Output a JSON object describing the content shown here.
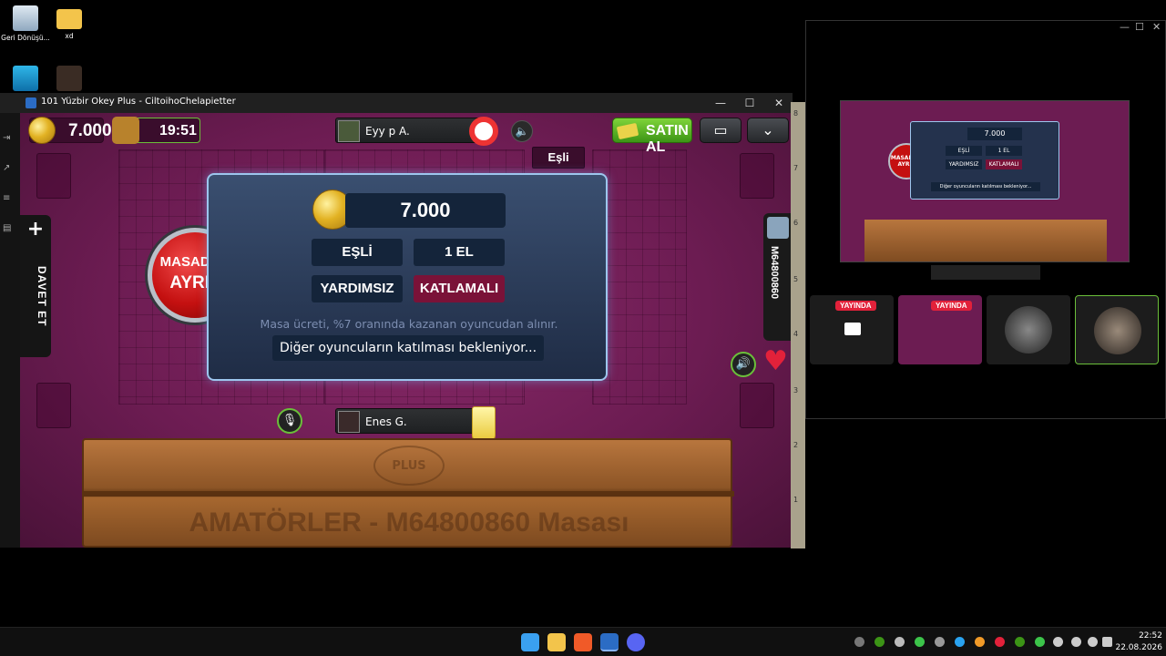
{
  "desktop": {
    "icons": [
      {
        "name": "recycle-bin",
        "label": "Geri Dönüşü..."
      },
      {
        "name": "folder",
        "label": "xd"
      }
    ]
  },
  "window": {
    "title": "101 Yüzbir Okey Plus - CiltoihoChelapietter",
    "minimize": "—",
    "maximize": "☐",
    "close": "✕"
  },
  "hud": {
    "chips": "7.000",
    "timer": "19:51",
    "top_player": "Eyy p A.",
    "buy_label": "SATIN AL",
    "team_label": "Eşli"
  },
  "left_panel": {
    "invite_label": "DAVET ET"
  },
  "right_player": {
    "name": "M64800860"
  },
  "leave_button": {
    "line1": "MASADAN",
    "line2": "AYRIL"
  },
  "dialog": {
    "fee": "7.000",
    "options": [
      "EŞLİ",
      "1 EL",
      "YARDIMSIZ",
      "KATLAMALI"
    ],
    "active_option": "KATLAMALI",
    "fee_note": "Masa ücreti, %7 oranında kazanan oyuncudan alınır.",
    "waiting": "Diğer oyuncuların katılması bekleniyor..."
  },
  "bottom_player": {
    "name": "Enes G."
  },
  "rack": {
    "logo": "PLUS",
    "table_name": "AMATÖRLER - M64800860 Masası"
  },
  "side_ruler": [
    "8",
    "7",
    "6",
    "5",
    "4",
    "3",
    "2",
    "1"
  ],
  "stream_window": {
    "preview_leave": "MASADAN AYRIL",
    "preview_fee": "7.000",
    "preview_options": [
      "EŞLİ",
      "1 EL",
      "YARDIMSIZ",
      "KATLAMALI"
    ],
    "preview_wait": "Diğer oyuncuların katılması bekleniyor...",
    "live_badge": "YAYINDA"
  },
  "taskbar": {
    "time": "22:52",
    "date": "22.08.2026"
  },
  "colors": {
    "felt": "#6c1c52",
    "dialog_border": "#9dc6ee",
    "active_option": "#7a1238",
    "buy_green": "#3c9416",
    "leave_red": "#c41010"
  }
}
